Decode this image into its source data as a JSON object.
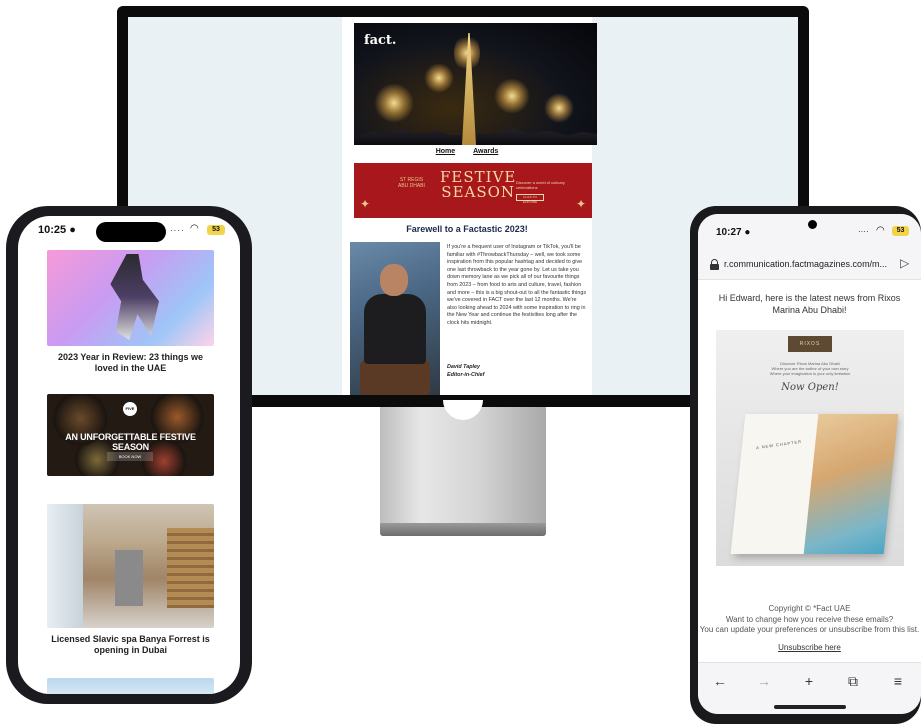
{
  "desktop": {
    "logo": "fact.",
    "nav": [
      "Home",
      "Awards"
    ],
    "banner": {
      "brand": "ST REGIS\nABU DHABI",
      "title_line1": "FESTIVE",
      "title_line2": "SEASON",
      "subtitle": "Discover a world of culinary celebrations",
      "button": "CLICK TO EXPLORE"
    },
    "heading": "Farewell to a Factastic 2023!",
    "body": "If you're a frequent user of Instagram or TikTok, you'll be familiar with #ThrowbackThursday – well, we took some inspiration from this popular hashtag and decided to give one last throwback to the year gone by. Let us take you down memory lane as we pick all of our favourite things from 2023 – from food to arts and culture, travel, fashion and more – this is a big shout-out to all the fantastic things we've covered in FACT over the last 12 months. We're also looking ahead to 2024 with some inspiration to ring in the New Year and continue the festivities long after the clock hits midnight.",
    "signature_name": "David Tapley",
    "signature_title": "Editor-in-Chief"
  },
  "iphone": {
    "time": "10:25",
    "battery": "53",
    "cards": [
      {
        "caption": "2023 Year in Review: 23 things we loved in the UAE"
      },
      {
        "logo": "FIVE",
        "title": "AN UNFORGETTABLE FESTIVE SEASON",
        "button": "BOOK NOW"
      },
      {
        "caption": "Licensed Slavic spa Banya Forrest is opening in Dubai"
      }
    ]
  },
  "android": {
    "time": "10:27",
    "battery": "53",
    "url": "r.communication.factmagazines.com/m...",
    "greeting": "Hi Edward, here is the latest news from Rixos Marina Abu Dhabi!",
    "hero": {
      "logo": "RIXOS",
      "subtitle": "Discover Rixos Marina Abu Dhabi\nWhere you are the author of your own story\nWhere your imagination is your only limitation",
      "script": "Now Open!",
      "book_text": "A NEW CHAPTER"
    },
    "footer_lines": [
      "Copyright © *Fact UAE",
      "Want to change how you receive these emails?",
      "You can update your preferences or unsubscribe from this list."
    ],
    "unsubscribe": "Unsubscribe here",
    "nav": [
      "←",
      "→",
      "+",
      "⧉",
      "≡"
    ]
  }
}
